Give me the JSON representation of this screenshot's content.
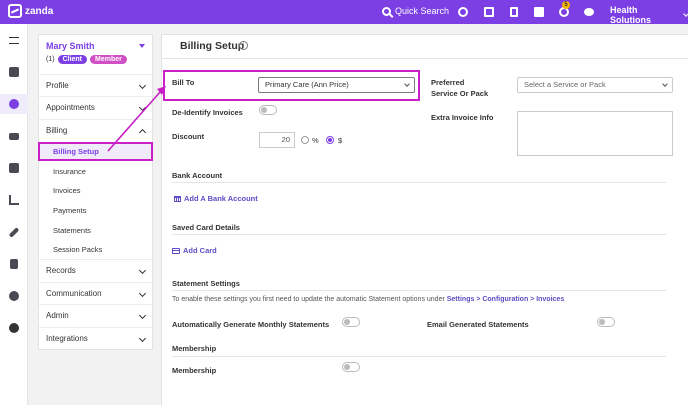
{
  "topbar": {
    "brand": "zanda",
    "quick_search": "Quick Search",
    "notification_count": "5",
    "org_name": "Health Solutions"
  },
  "client": {
    "name": "Mary Smith",
    "count": "(1)",
    "tag_client": "Client",
    "tag_member": "Member"
  },
  "sidebar": {
    "profile": "Profile",
    "appointments": "Appointments",
    "billing": "Billing",
    "billing_items": [
      "Billing Setup",
      "Insurance",
      "Invoices",
      "Payments",
      "Statements",
      "Session Packs"
    ],
    "records": "Records",
    "communication": "Communication",
    "admin": "Admin",
    "integrations": "Integrations"
  },
  "main": {
    "title": "Billing Setup",
    "bill_to_label": "Bill To",
    "bill_to_value": "Primary Care (Ann Price)",
    "deidentify_label": "De-Identify Invoices",
    "discount_label": "Discount",
    "discount_value": "20",
    "percent_label": "%",
    "dollar_label": "$",
    "preferred_label_1": "Preferred",
    "preferred_label_2": "Service Or Pack",
    "preferred_placeholder": "Select a Service or Pack",
    "extra_info_label": "Extra Invoice Info",
    "bank_account_heading": "Bank Account",
    "add_bank_account": "Add A Bank Account",
    "saved_card_heading": "Saved Card Details",
    "add_card": "Add Card",
    "statement_heading": "Statement Settings",
    "statement_text": "To enable these settings you first need to update the automatic Statement options under",
    "statement_link": "Settings > Configuration > Invoices",
    "auto_monthly": "Automatically Generate Monthly Statements",
    "email_statements": "Email Generated Statements",
    "membership_heading": "Membership",
    "membership_label": "Membership"
  },
  "colors": {
    "brand": "#7b3fe4",
    "highlight": "#c81fc6",
    "link": "#5b4ec4"
  }
}
